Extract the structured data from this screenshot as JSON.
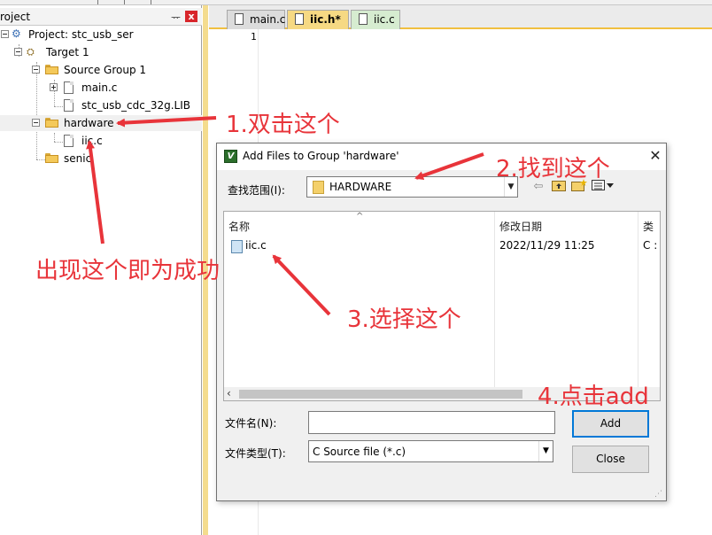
{
  "project_panel": {
    "title": "roject",
    "pin_glyph": "ᅲ",
    "close_glyph": "x",
    "tree": {
      "project": "Project: stc_usb_ser",
      "target": "Target 1",
      "source_group": "Source Group 1",
      "main_c": "main.c",
      "lib_file": "stc_usb_cdc_32g.LIB",
      "hardware": "hardware",
      "iic_c": "iic.c",
      "senior": "senic"
    }
  },
  "editor": {
    "tabs": [
      {
        "label": "main.c",
        "state": "normal"
      },
      {
        "label": "iic.h*",
        "state": "active"
      },
      {
        "label": "iic.c",
        "state": "green"
      }
    ],
    "line_number": "1"
  },
  "dialog": {
    "title": "Add Files to Group 'hardware'",
    "close_glyph": "✕",
    "look_in_label": "查找范围(I):",
    "look_in_value": "HARDWARE",
    "columns": {
      "name": "名称",
      "date": "修改日期",
      "type": "类"
    },
    "file": {
      "name": "iic.c",
      "date": "2022/11/29 11:25",
      "type": "C :"
    },
    "filename_label": "文件名(N):",
    "filename_value": "",
    "filetype_label": "文件类型(T):",
    "filetype_value": "C Source file (*.c)",
    "add_label": "Add",
    "close_label": "Close"
  },
  "annotations": {
    "step1": "1.双击这个",
    "step2": "2.找到这个",
    "step3": "3.选择这个",
    "step4": "4.点击add",
    "result": "出现这个即为成功"
  },
  "colors": {
    "annotation": "#e8343a",
    "active_tab": "#f6d983",
    "dialog_bg": "#f0f0f0",
    "accent": "#0078d7"
  }
}
